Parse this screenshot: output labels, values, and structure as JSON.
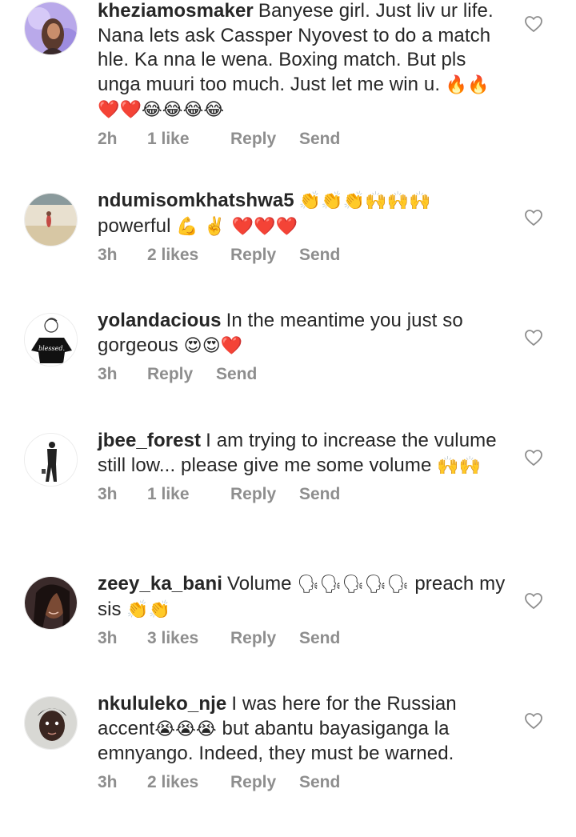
{
  "comments": [
    {
      "username": "kheziamosmaker",
      "text": "Banyese girl. Just liv ur life. Nana lets ask Cassper Nyovest to do a match hle. Ka nna le wena. Boxing match. But pls unga muuri too much. Just let me win u.",
      "emojis": "🔥🔥❤️❤️😂😂😂😂",
      "time": "2h",
      "likes": "1 like",
      "reply": "Reply",
      "send": "Send"
    },
    {
      "username": "ndumisomkhatshwa5",
      "text": "",
      "emojis_inline": "👏👏👏🙌🙌🙌",
      "line2_text": "powerful",
      "emojis": "💪 ✌️ ❤️❤️❤️",
      "time": "3h",
      "likes": "2 likes",
      "reply": "Reply",
      "send": "Send"
    },
    {
      "username": "yolandacious",
      "text": "In the meantime you just so gorgeous",
      "emojis": "😍😍❤️",
      "time": "3h",
      "likes": "",
      "reply": "Reply",
      "send": "Send"
    },
    {
      "username": "jbee_forest",
      "text": "I am trying to increase the vulume still low... please give me some volume",
      "emojis": "🙌🙌",
      "time": "3h",
      "likes": "1 like",
      "reply": "Reply",
      "send": "Send"
    },
    {
      "username": "zeey_ka_bani",
      "text": "Volume",
      "emojis_inline": "🗣🗣🗣🗣🗣",
      "line2_text": "preach my sis",
      "emojis": "👏👏",
      "time": "3h",
      "likes": "3 likes",
      "reply": "Reply",
      "send": "Send"
    },
    {
      "username": "nkululeko_nje",
      "text": "I was here for the Russian accent",
      "emojis_inline": "😭😭😭",
      "line2_text": "but abantu bayasiganga la emnyango. Indeed, they must be warned.",
      "emojis": "",
      "time": "3h",
      "likes": "2 likes",
      "reply": "Reply",
      "send": "Send"
    }
  ],
  "icons": {
    "like": "heart-outline-icon"
  },
  "colors": {
    "text": "#262626",
    "meta": "#8e8e8e",
    "heart": "#8e8e8e"
  }
}
